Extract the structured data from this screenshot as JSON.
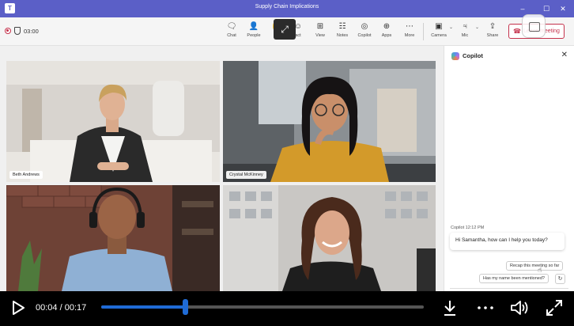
{
  "window": {
    "title": "Supply Chain Implications",
    "controls": [
      "–",
      "☐",
      "✕"
    ]
  },
  "toolbar": {
    "timer": "03:00",
    "items": [
      {
        "key": "chat",
        "label": "Chat",
        "icon": "chat-icon",
        "glyph": "🗨"
      },
      {
        "key": "people",
        "label": "People",
        "icon": "people-icon",
        "glyph": "👤"
      },
      {
        "key": "raise",
        "label": "R",
        "icon": "hand-icon",
        "glyph": "✋"
      },
      {
        "key": "react",
        "label": "act",
        "icon": "react-icon",
        "glyph": "☺"
      },
      {
        "key": "view",
        "label": "View",
        "icon": "view-icon",
        "glyph": "⊞"
      },
      {
        "key": "notes",
        "label": "Notes",
        "icon": "notes-icon",
        "glyph": "☷"
      },
      {
        "key": "copilot",
        "label": "Copilot",
        "icon": "copilot-icon",
        "glyph": "◎"
      },
      {
        "key": "apps",
        "label": "Apps",
        "icon": "apps-icon",
        "glyph": "⊕"
      },
      {
        "key": "more",
        "label": "More",
        "icon": "more-icon",
        "glyph": "⋯"
      },
      {
        "key": "camera",
        "label": "Camera",
        "icon": "camera-icon",
        "glyph": "▣"
      },
      {
        "key": "mic",
        "label": "Mic",
        "icon": "mic-icon",
        "glyph": "♃"
      },
      {
        "key": "share",
        "label": "Share",
        "icon": "share-icon",
        "glyph": "⇪"
      }
    ],
    "leave_label": "Leave meeting"
  },
  "participants": [
    {
      "name": "Beth Andrews"
    },
    {
      "name": "Crystal McKinney"
    },
    {
      "name": ""
    },
    {
      "name": ""
    }
  ],
  "copilot": {
    "title": "Copilot",
    "message_meta": "Copilot 12:12 PM",
    "message": "Hi Samantha, how can I help you today?",
    "suggestions": [
      "Recap this meeting so far",
      "Has my name been mentioned?"
    ]
  },
  "player": {
    "current": "00:04",
    "duration": "00:17",
    "progress_fraction": 0.26
  },
  "colors": {
    "brand": "#5b5fc7",
    "leave": "#c4314b",
    "progress": "#1f6bd6"
  }
}
